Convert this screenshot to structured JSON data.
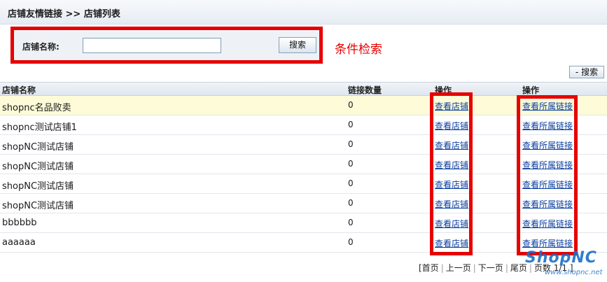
{
  "header": {
    "title": "店铺友情链接 >> 店铺列表"
  },
  "search": {
    "label": "店铺名称:",
    "value": "",
    "button_label": "搜索"
  },
  "annotation": {
    "text": "条件检索"
  },
  "toggle": {
    "label": "- 搜索"
  },
  "table": {
    "headers": [
      "店铺名称",
      "链接数量",
      "操作",
      "操作"
    ],
    "rows": [
      {
        "name": "shopnc名品败卖",
        "count": "0",
        "view_store": "查看店铺",
        "view_links": "查看所属链接"
      },
      {
        "name": "shopnc测试店铺1",
        "count": "0",
        "view_store": "查看店铺",
        "view_links": "查看所属链接"
      },
      {
        "name": "shopNC测试店铺",
        "count": "0",
        "view_store": "查看店铺",
        "view_links": "查看所属链接"
      },
      {
        "name": "shopNC测试店铺",
        "count": "0",
        "view_store": "查看店铺",
        "view_links": "查看所属链接"
      },
      {
        "name": "shopNC测试店铺",
        "count": "0",
        "view_store": "查看店铺",
        "view_links": "查看所属链接"
      },
      {
        "name": "shopNC测试店铺",
        "count": "0",
        "view_store": "查看店铺",
        "view_links": "查看所属链接"
      },
      {
        "name": "bbbbbb",
        "count": "0",
        "view_store": "查看店铺",
        "view_links": "查看所属链接"
      },
      {
        "name": "aaaaaa",
        "count": "0",
        "view_store": "查看店铺",
        "view_links": "查看所属链接"
      }
    ]
  },
  "pager": {
    "first": "[首页",
    "prev": "上一页",
    "next": "下一页",
    "last": "尾页",
    "info": "页数 1/1 ]"
  },
  "watermark": {
    "brand": "ShopNC",
    "site": "www.shopnc.net"
  },
  "colors": {
    "highlight": "#e60000",
    "link": "#0a3ea0",
    "row_highlight": "#fdfbd8"
  }
}
